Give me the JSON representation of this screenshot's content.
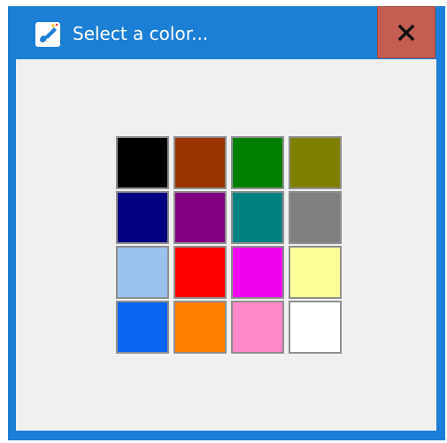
{
  "window": {
    "title": "Select a color...",
    "title_icon": "paint-brush-icon",
    "close_label": "X",
    "titlebar_color": "#1c7fd6",
    "close_color": "#c45e52"
  },
  "swatches": [
    {
      "name": "black",
      "color": "#000000"
    },
    {
      "name": "brown",
      "color": "#993300"
    },
    {
      "name": "green",
      "color": "#008000"
    },
    {
      "name": "olive",
      "color": "#808000"
    },
    {
      "name": "navy",
      "color": "#000080"
    },
    {
      "name": "purple",
      "color": "#800080"
    },
    {
      "name": "teal",
      "color": "#008080"
    },
    {
      "name": "gray",
      "color": "#808080"
    },
    {
      "name": "light-blue",
      "color": "#99c2ee"
    },
    {
      "name": "red",
      "color": "#ff0000"
    },
    {
      "name": "magenta",
      "color": "#ee00ee"
    },
    {
      "name": "light-yellow",
      "color": "#ffff99"
    },
    {
      "name": "blue",
      "color": "#0a64f0"
    },
    {
      "name": "orange",
      "color": "#ff7f00"
    },
    {
      "name": "pink",
      "color": "#ff88c8"
    },
    {
      "name": "white",
      "color": "#ffffff"
    }
  ]
}
